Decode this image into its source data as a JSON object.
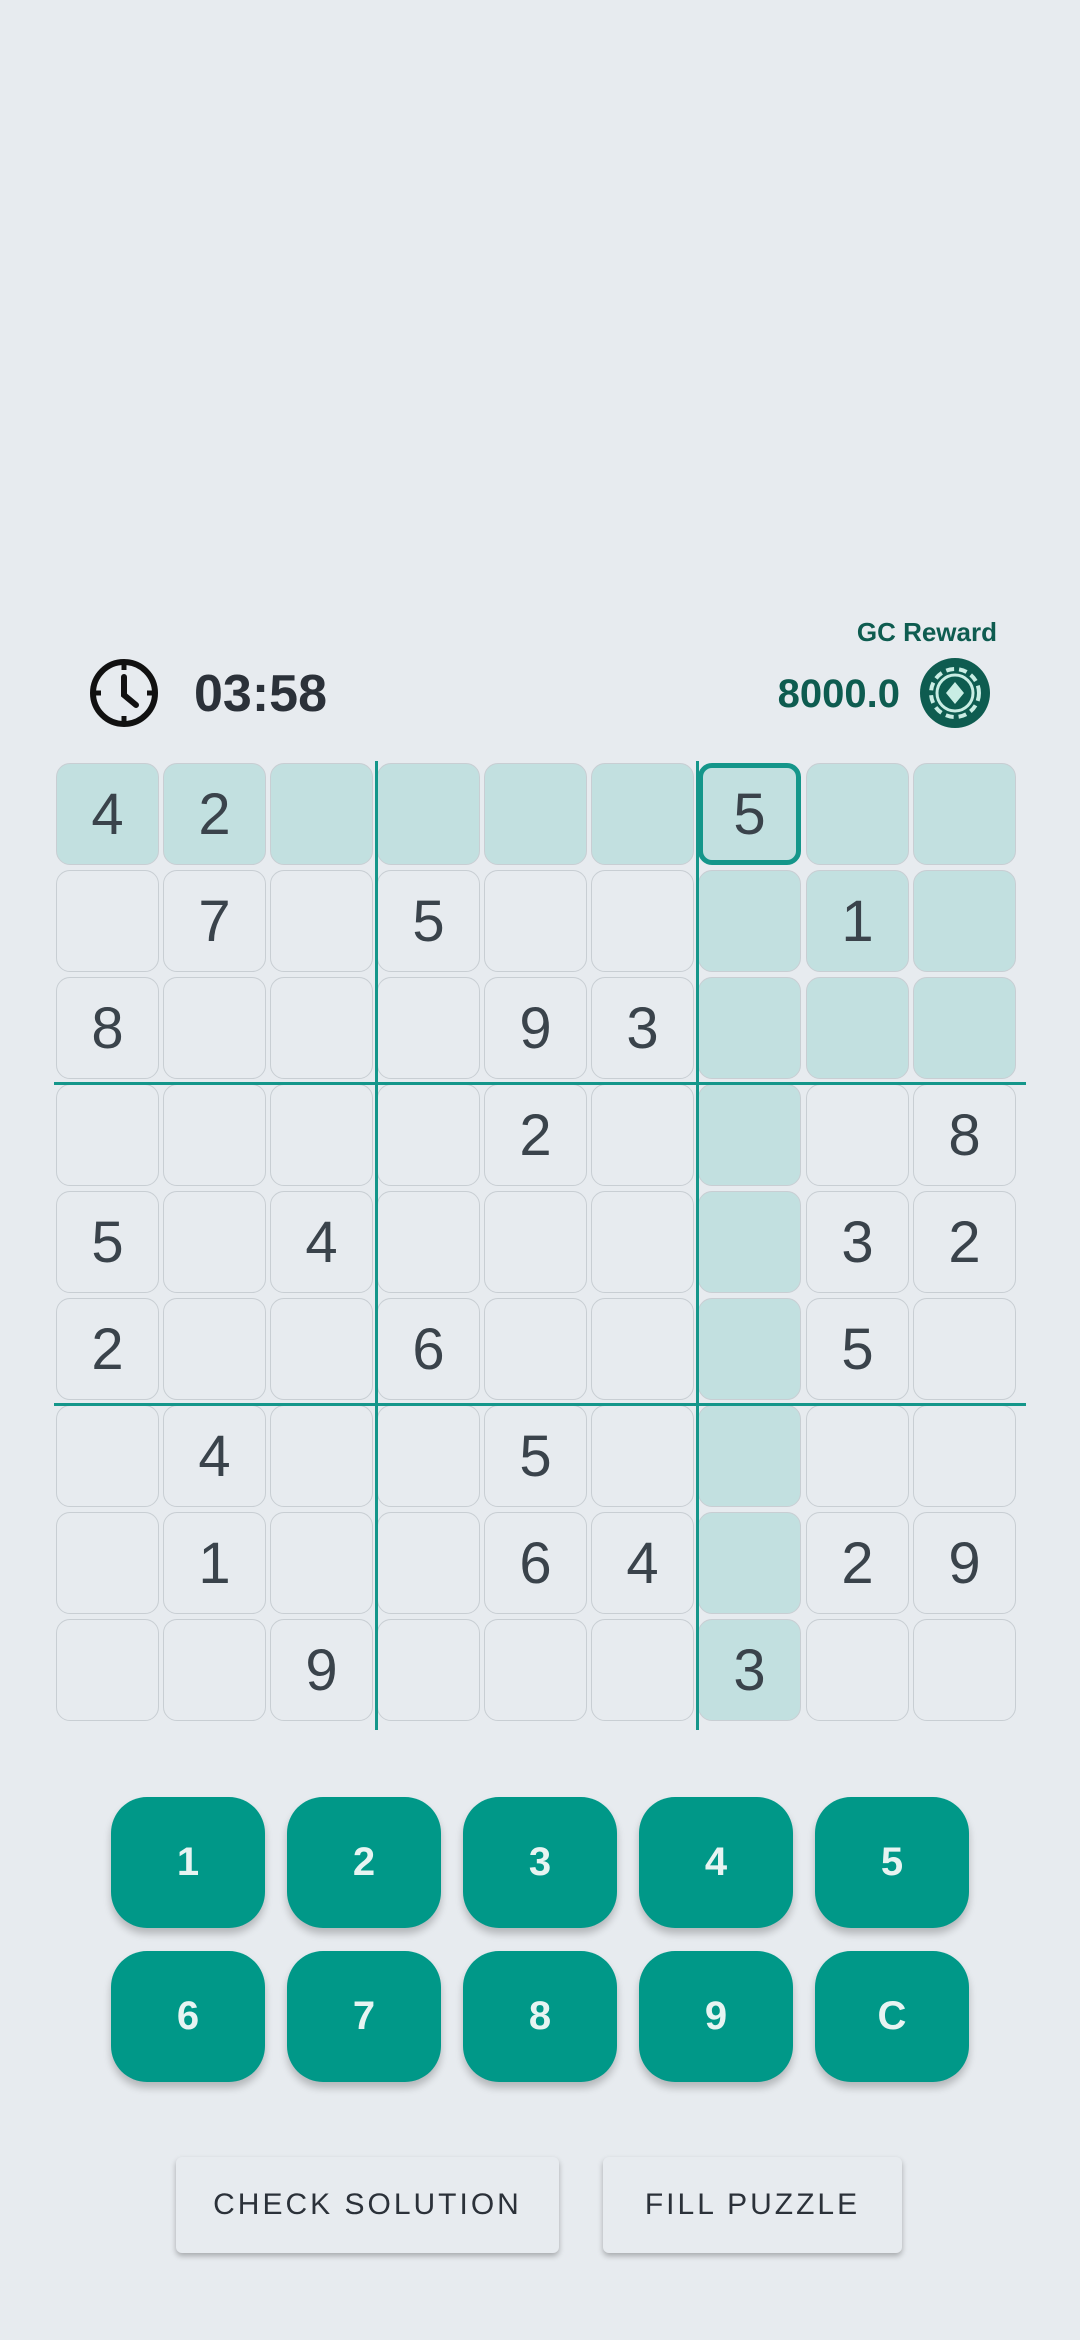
{
  "header": {
    "timer": "03:58",
    "reward_label": "GC Reward",
    "reward_value": "8000.0",
    "timer_icon": "clock-icon",
    "reward_icon": "coin-icon"
  },
  "board": {
    "rows": [
      [
        "4",
        "2",
        "",
        "",
        "",
        "",
        "5",
        "",
        ""
      ],
      [
        "",
        "7",
        "",
        "5",
        "",
        "",
        "",
        "1",
        ""
      ],
      [
        "8",
        "",
        "",
        "",
        "9",
        "3",
        "",
        "",
        ""
      ],
      [
        "",
        "",
        "",
        "",
        "2",
        "",
        "",
        "",
        "8"
      ],
      [
        "5",
        "",
        "4",
        "",
        "",
        "",
        "",
        "3",
        "2"
      ],
      [
        "2",
        "",
        "",
        "6",
        "",
        "",
        "",
        "5",
        ""
      ],
      [
        "",
        "4",
        "",
        "",
        "5",
        "",
        "",
        "",
        ""
      ],
      [
        "",
        "1",
        "",
        "",
        "6",
        "4",
        "",
        "2",
        "9"
      ],
      [
        "",
        "",
        "9",
        "",
        "",
        "",
        "3",
        "",
        ""
      ]
    ],
    "selected": {
      "row": 0,
      "col": 6
    }
  },
  "keypad": {
    "keys": [
      "1",
      "2",
      "3",
      "4",
      "5",
      "6",
      "7",
      "8",
      "9",
      "C"
    ]
  },
  "actions": {
    "check": "CHECK SOLUTION",
    "fill": "FILL PUZZLE"
  },
  "colors": {
    "accent": "#009888",
    "highlight": "#c2e0e0",
    "background": "#e7ebef"
  }
}
